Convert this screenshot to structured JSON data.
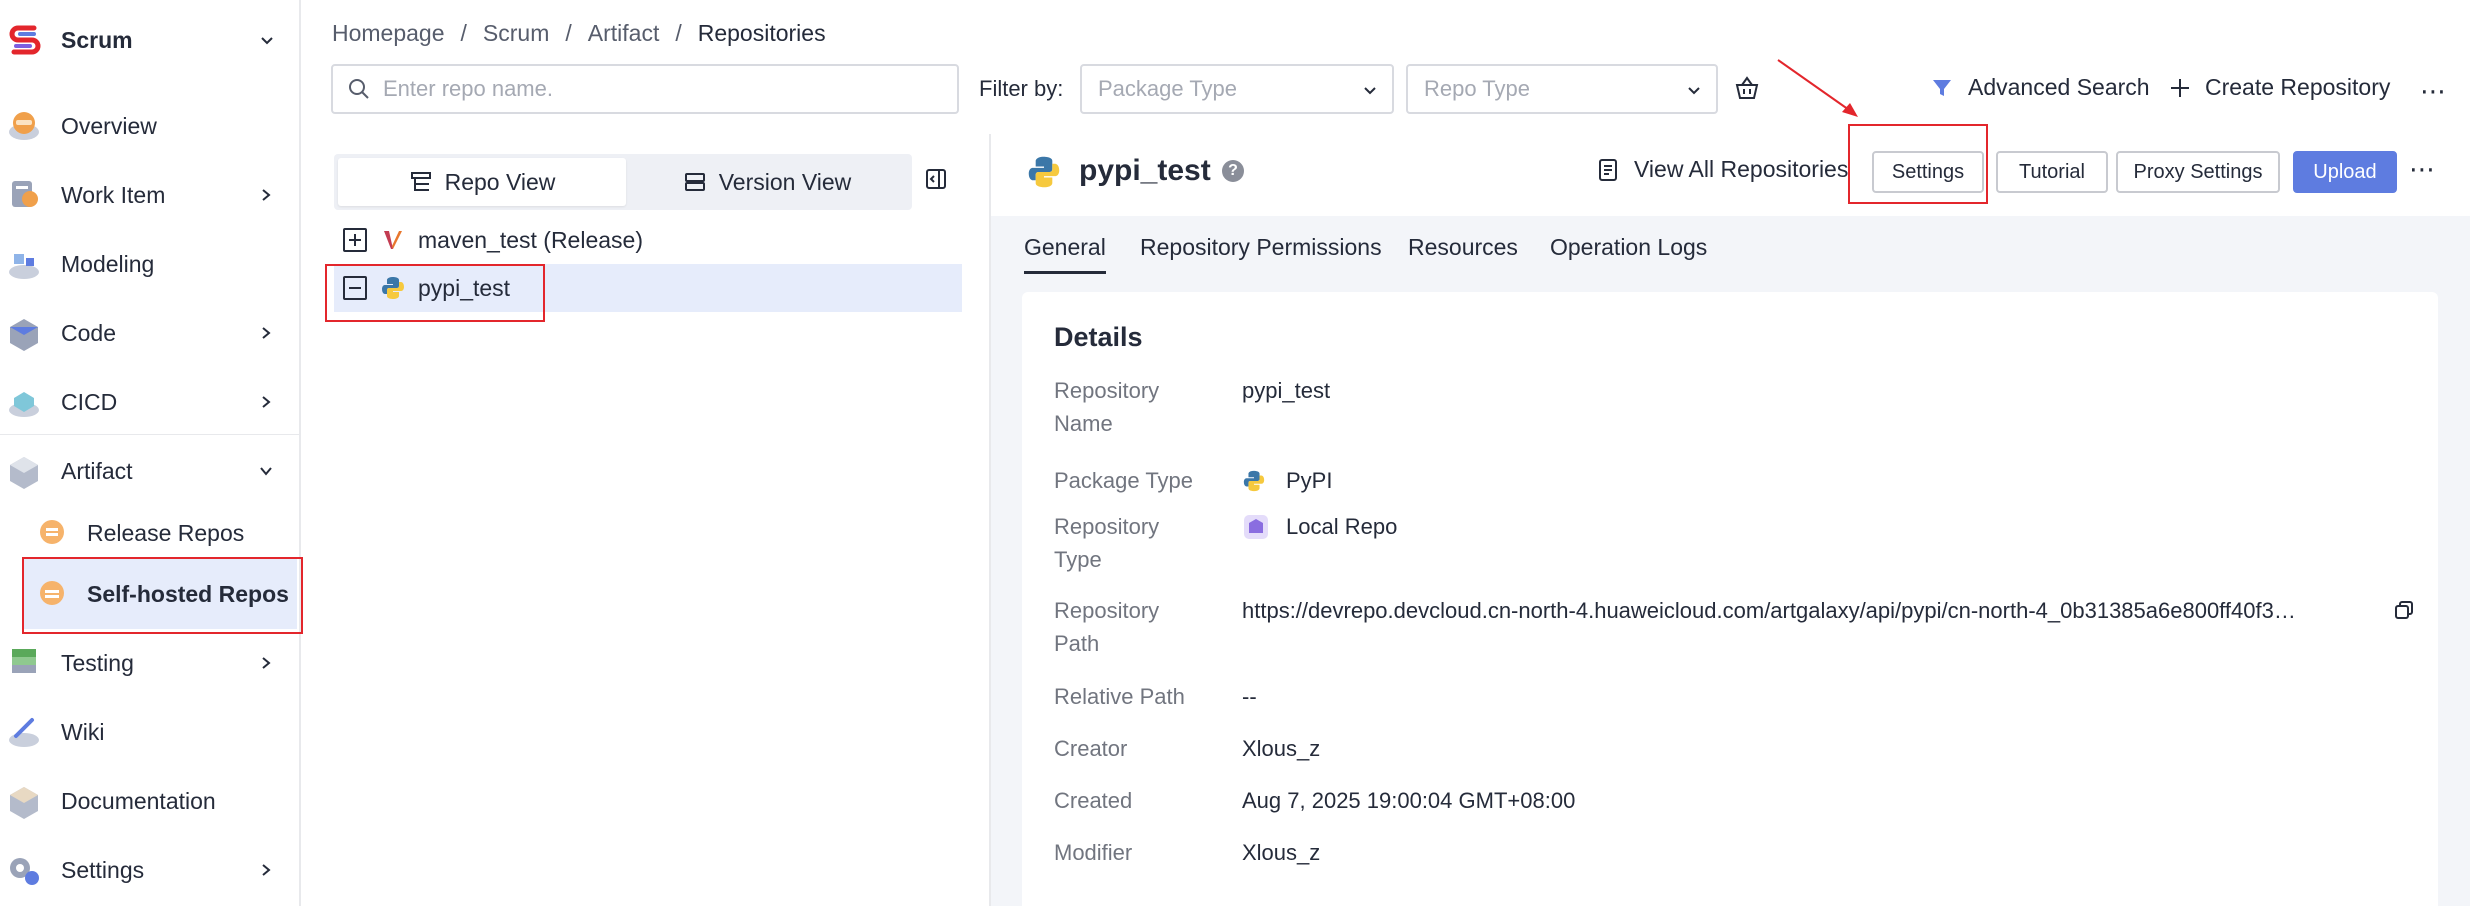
{
  "sidebar": {
    "brand": "Scrum",
    "items": [
      {
        "label": "Overview"
      },
      {
        "label": "Work Item"
      },
      {
        "label": "Modeling"
      },
      {
        "label": "Code"
      },
      {
        "label": "CICD"
      },
      {
        "label": "Artifact"
      },
      {
        "label": "Testing"
      },
      {
        "label": "Wiki"
      },
      {
        "label": "Documentation"
      },
      {
        "label": "Settings"
      }
    ],
    "sub_items": [
      {
        "label": "Release Repos"
      },
      {
        "label": "Self-hosted Repos"
      }
    ]
  },
  "breadcrumb": [
    "Homepage",
    "/",
    "Scrum",
    "/",
    "Artifact",
    "/",
    "Repositories"
  ],
  "search": {
    "placeholder": "Enter repo name."
  },
  "filter": {
    "label": "Filter by:",
    "package_type_placeholder": "Package Type",
    "repo_type_placeholder": "Repo Type"
  },
  "toolbar": {
    "advanced_search": "Advanced Search",
    "create_repository": "Create Repository"
  },
  "view_toggle": {
    "repo_view": "Repo View",
    "version_view": "Version View"
  },
  "tree": [
    {
      "label": "maven_test (Release)"
    },
    {
      "label": "pypi_test"
    }
  ],
  "detail": {
    "title": "pypi_test",
    "view_all": "View All Repositories",
    "buttons": {
      "settings": "Settings",
      "tutorial": "Tutorial",
      "proxy_settings": "Proxy Settings",
      "upload": "Upload"
    },
    "tabs": [
      "General",
      "Repository Permissions",
      "Resources",
      "Operation Logs"
    ],
    "section_title": "Details",
    "rows": [
      {
        "label": "Repository Name",
        "value": "pypi_test"
      },
      {
        "label": "Package Type",
        "value": "PyPI"
      },
      {
        "label": "Repository Type",
        "value": "Local Repo"
      },
      {
        "label": "Repository Path",
        "value": "https://devrepo.devcloud.cn-north-4.huaweicloud.com/artgalaxy/api/pypi/cn-north-4_0b31385a6e800ff40f3…"
      },
      {
        "label": "Relative Path",
        "value": "--"
      },
      {
        "label": "Creator",
        "value": "Xlous_z"
      },
      {
        "label": "Created",
        "value": "Aug 7, 2025 19:00:04 GMT+08:00"
      },
      {
        "label": "Modifier",
        "value": "Xlous_z"
      }
    ]
  },
  "colors": {
    "accent": "#5e7ce0",
    "selected_bg": "#e6ecfb",
    "annotation_red": "#e3262c"
  }
}
